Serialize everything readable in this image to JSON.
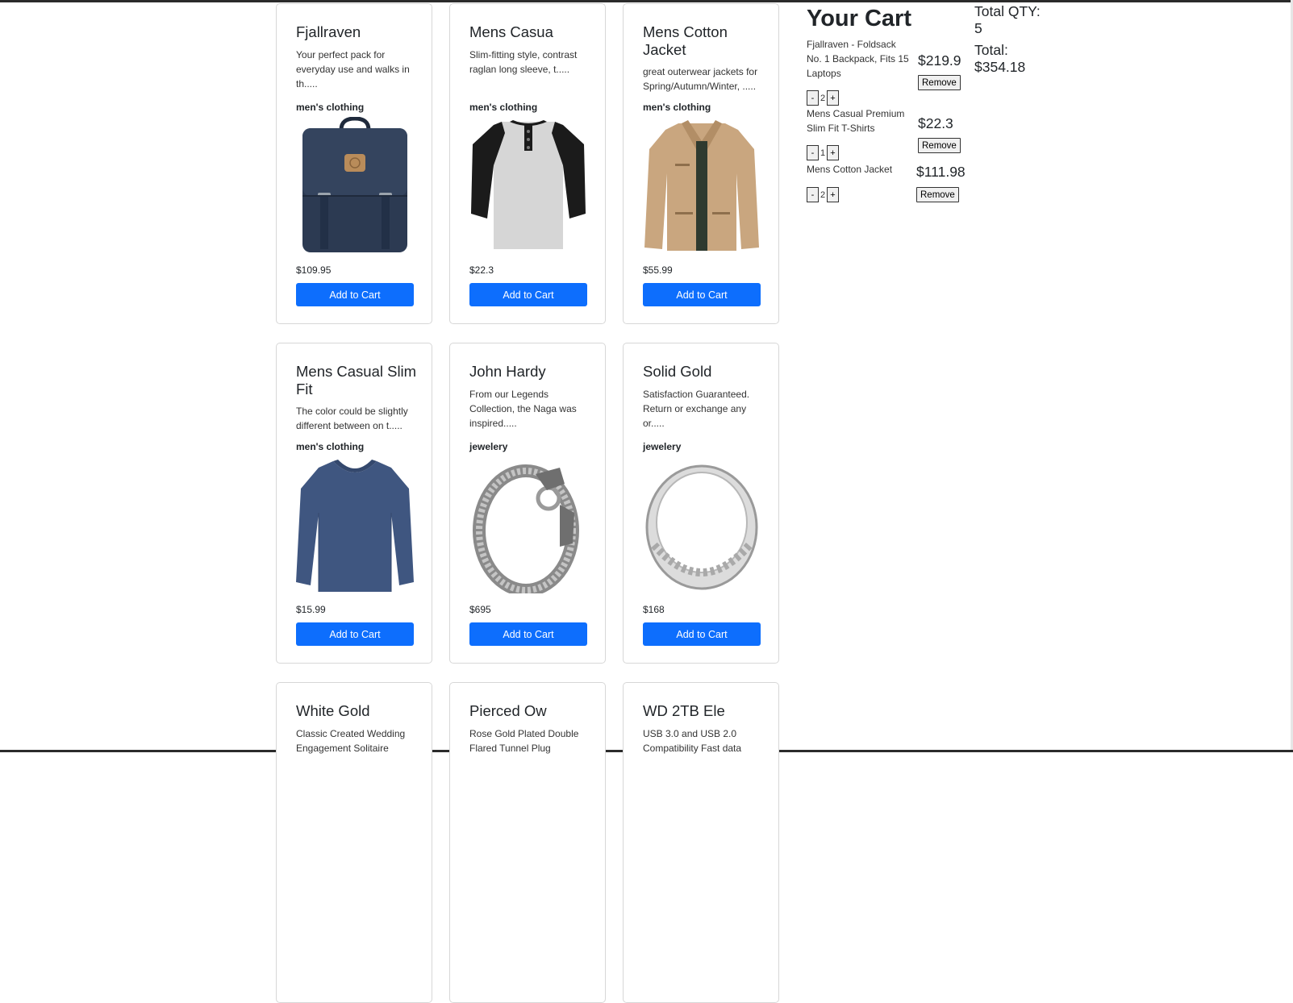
{
  "products": [
    {
      "title": "Fjallraven",
      "desc": "Your perfect pack for everyday use and walks in th.....",
      "category": "men's clothing",
      "price": "$109.95",
      "image_icon": "backpack-image",
      "button": "Add to Cart"
    },
    {
      "title": "Mens Casua",
      "desc": "Slim-fitting style, contrast raglan long sleeve, t.....",
      "category": "men's clothing",
      "price": "$22.3",
      "image_icon": "raglan-tshirt-image",
      "button": "Add to Cart"
    },
    {
      "title": "Mens Cotton Jacket",
      "desc": "great outerwear jackets for Spring/Autumn/Winter, .....",
      "category": "men's clothing",
      "price": "$55.99",
      "image_icon": "cotton-jacket-image",
      "button": "Add to Cart"
    },
    {
      "title": "Mens Casual Slim Fit",
      "desc": "The color could be slightly different between on t.....",
      "category": "men's clothing",
      "price": "$15.99",
      "image_icon": "longsleeve-shirt-image",
      "button": "Add to Cart"
    },
    {
      "title": "John Hardy",
      "desc": "From our Legends Collection, the Naga was inspired.....",
      "category": "jewelery",
      "price": "$695",
      "image_icon": "dragon-bracelet-image",
      "button": "Add to Cart"
    },
    {
      "title": "Solid Gold",
      "desc": "Satisfaction Guaranteed. Return or exchange any or.....",
      "category": "jewelery",
      "price": "$168",
      "image_icon": "silver-ring-image",
      "button": "Add to Cart"
    },
    {
      "title": "White Gold",
      "desc": "Classic Created Wedding Engagement Solitaire",
      "category": "",
      "price": "",
      "image_icon": "",
      "button": ""
    },
    {
      "title": "Pierced Ow",
      "desc": "Rose Gold Plated Double Flared Tunnel Plug",
      "category": "",
      "price": "",
      "image_icon": "",
      "button": ""
    },
    {
      "title": "WD 2TB Ele",
      "desc": "USB 3.0 and USB 2.0 Compatibility Fast data",
      "category": "",
      "price": "",
      "image_icon": "",
      "button": ""
    }
  ],
  "cart": {
    "title": "Your Cart",
    "items": [
      {
        "name": "Fjallraven - Foldsack No. 1 Backpack, Fits 15 Laptops",
        "price": "$219.9",
        "qty": "2",
        "remove": "Remove",
        "minus": "-",
        "plus": "+"
      },
      {
        "name": "Mens Casual Premium Slim Fit T-Shirts",
        "price": "$22.3",
        "qty": "1",
        "remove": "Remove",
        "minus": "-",
        "plus": "+"
      },
      {
        "name": "Mens Cotton Jacket",
        "price": "$111.98",
        "qty": "2",
        "remove": "Remove",
        "minus": "-",
        "plus": "+"
      }
    ]
  },
  "totals": {
    "qty_label": "Total QTY:",
    "qty_value": "5",
    "total_label": "Total:",
    "total_value": "$354.18"
  },
  "colors": {
    "button_blue": "#0d6efd",
    "card_border": "#d7d7d7",
    "backpack_navy": "#2c3a52",
    "jacket_khaki": "#c9a67f",
    "shirt_blue": "#3f5680"
  }
}
